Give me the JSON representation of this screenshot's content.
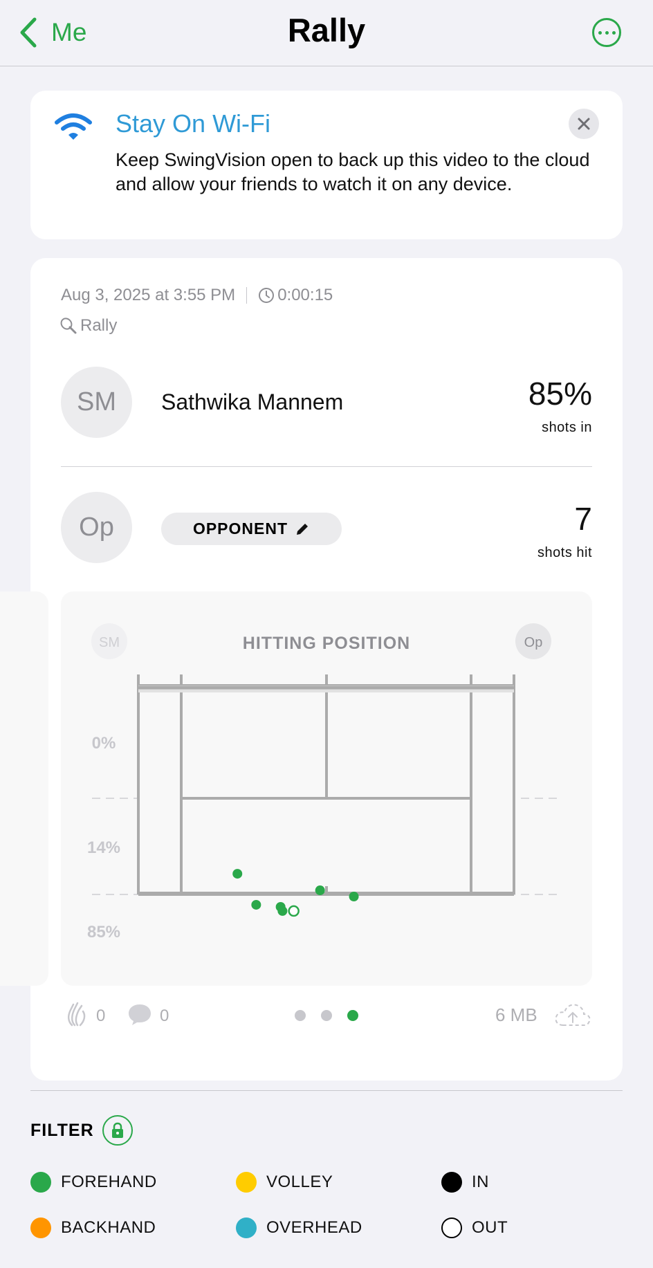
{
  "nav": {
    "back_label": "Me",
    "title": "Rally"
  },
  "banner": {
    "title": "Stay On Wi-Fi",
    "body": "Keep SwingVision open to back up this video to the cloud and allow your friends to watch it on any device."
  },
  "session": {
    "date": "Aug 3, 2025 at 3:55 PM",
    "duration": "0:00:15",
    "type": "Rally"
  },
  "player": {
    "initials": "SM",
    "name": "Sathwika Mannem",
    "stat_value": "85%",
    "stat_label": "shots in"
  },
  "opponent": {
    "initials": "Op",
    "label": "OPPONENT",
    "stat_value": "7",
    "stat_label": "shots hit"
  },
  "chart": {
    "title": "HITTING POSITION",
    "left_badge": "SM",
    "right_badge": "Op",
    "zone_labels": [
      "0%",
      "14%",
      "85%"
    ]
  },
  "chart_data": {
    "type": "scatter",
    "title": "HITTING POSITION",
    "zones": [
      {
        "label": "0%",
        "value": 0
      },
      {
        "label": "14%",
        "value": 14
      },
      {
        "label": "85%",
        "value": 85
      }
    ],
    "points": [
      {
        "x": 0.47,
        "y": 0.9,
        "stroke": "forehand",
        "result": "in"
      },
      {
        "x": 0.52,
        "y": 1.05,
        "stroke": "forehand",
        "result": "in"
      },
      {
        "x": 0.585,
        "y": 1.06,
        "stroke": "forehand",
        "result": "in"
      },
      {
        "x": 0.59,
        "y": 1.08,
        "stroke": "forehand",
        "result": "in"
      },
      {
        "x": 0.62,
        "y": 1.08,
        "stroke": "forehand",
        "result": "out"
      },
      {
        "x": 0.69,
        "y": 0.98,
        "stroke": "forehand",
        "result": "in"
      },
      {
        "x": 0.78,
        "y": 1.01,
        "stroke": "forehand",
        "result": "in"
      }
    ]
  },
  "footer": {
    "likes": "0",
    "comments": "0",
    "size": "6 MB",
    "page_count": 3,
    "active_page": 3
  },
  "filter": {
    "title": "FILTER",
    "legend": [
      {
        "label": "FOREHAND",
        "color": "#2aa84a"
      },
      {
        "label": "VOLLEY",
        "color": "#ffcc00"
      },
      {
        "label": "IN",
        "color": "#000000"
      },
      {
        "label": "BACKHAND",
        "color": "#ff9500"
      },
      {
        "label": "OVERHEAD",
        "color": "#30b0c7"
      },
      {
        "label": "OUT",
        "color": "#ffffff"
      }
    ]
  }
}
